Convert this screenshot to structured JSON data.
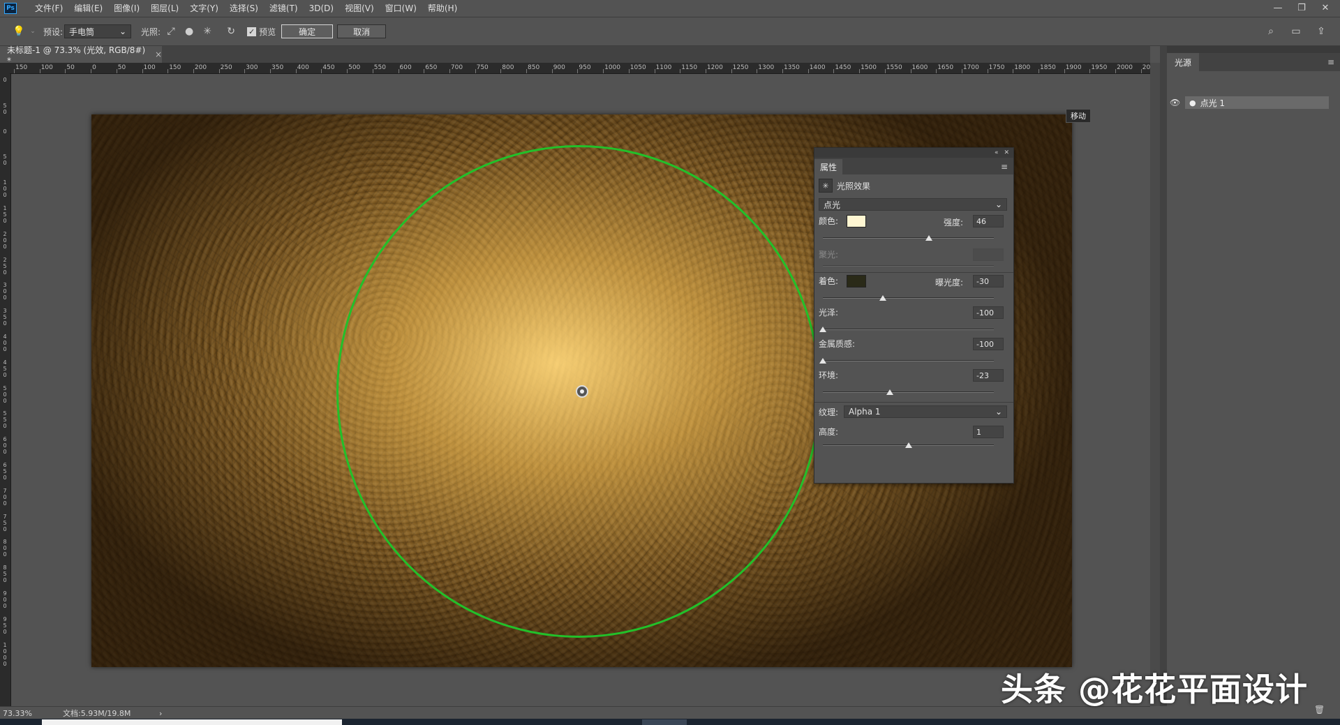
{
  "menu": {
    "logo": "Ps",
    "items": [
      "文件(F)",
      "编辑(E)",
      "图像(I)",
      "图层(L)",
      "文字(Y)",
      "选择(S)",
      "滤镜(T)",
      "3D(D)",
      "视图(V)",
      "窗口(W)",
      "帮助(H)"
    ]
  },
  "window_controls": {
    "minimize": "—",
    "restore": "❐",
    "close": "✕"
  },
  "options": {
    "preset_label": "预设:",
    "preset_value": "手电筒",
    "light_label": "光照:",
    "preview_label": "预览",
    "ok_label": "确定",
    "cancel_label": "取消"
  },
  "document": {
    "tab_title": "未标题-1 @ 73.3% (光效, RGB/8#) *",
    "tab_close": "×",
    "tooltip_move": "移动"
  },
  "ruler": {
    "top_labels": [
      "150",
      "100",
      "50",
      "0",
      "50",
      "100",
      "150",
      "200",
      "250",
      "300",
      "350",
      "400",
      "450",
      "500",
      "550",
      "600",
      "650",
      "700",
      "750",
      "800",
      "850",
      "900",
      "950",
      "1000",
      "1050",
      "1100",
      "1150",
      "1200",
      "1250",
      "1300",
      "1350",
      "1400",
      "1450",
      "1500",
      "1550",
      "1600",
      "1650",
      "1700",
      "1750",
      "1800",
      "1850",
      "1900",
      "1950",
      "2000",
      "205"
    ],
    "left_labels": [
      "0",
      "5\n0",
      "0",
      "5\n0",
      "1\n0\n0",
      "1\n5\n0",
      "2\n0\n0",
      "2\n5\n0",
      "3\n0\n0",
      "3\n5\n0",
      "4\n0\n0",
      "4\n5\n0",
      "5\n0\n0",
      "5\n5\n0",
      "6\n0\n0",
      "6\n5\n0",
      "7\n0\n0",
      "7\n5\n0",
      "8\n0\n0",
      "8\n5\n0",
      "9\n0\n0",
      "9\n5\n0",
      "1\n0\n0\n0"
    ]
  },
  "properties": {
    "tab": "属性",
    "menu_icon": "≡",
    "header_icons": [
      "«",
      "✕"
    ],
    "effect_title": "光照效果",
    "light_type": "点光",
    "color_label": "颜色:",
    "color_value": "#fff6d2",
    "intensity_label": "强度:",
    "intensity_value": "46",
    "intensity_pct": 0.62,
    "hotspot_label": "聚光:",
    "colorize_label": "着色:",
    "colorize_value": "#2a2a18",
    "exposure_label": "曝光度:",
    "exposure_value": "-30",
    "exposure_pct": 0.35,
    "gloss_label": "光泽:",
    "gloss_value": "-100",
    "gloss_pct": 0.0,
    "metallic_label": "金属质感:",
    "metallic_value": "-100",
    "metallic_pct": 0.0,
    "ambience_label": "环境:",
    "ambience_value": "-23",
    "ambience_pct": 0.39,
    "texture_label": "纹理:",
    "texture_value": "Alpha 1",
    "height_label": "高度:",
    "height_value": "1",
    "height_pct": 0.5
  },
  "lights_panel": {
    "tab": "光源",
    "menu_icon": "≡",
    "item": "点光 1"
  },
  "status": {
    "zoom": "73.33%",
    "doc": "文档:5.93M/19.8M",
    "arrow": "›"
  },
  "watermark": "头条 @花花平面设计"
}
